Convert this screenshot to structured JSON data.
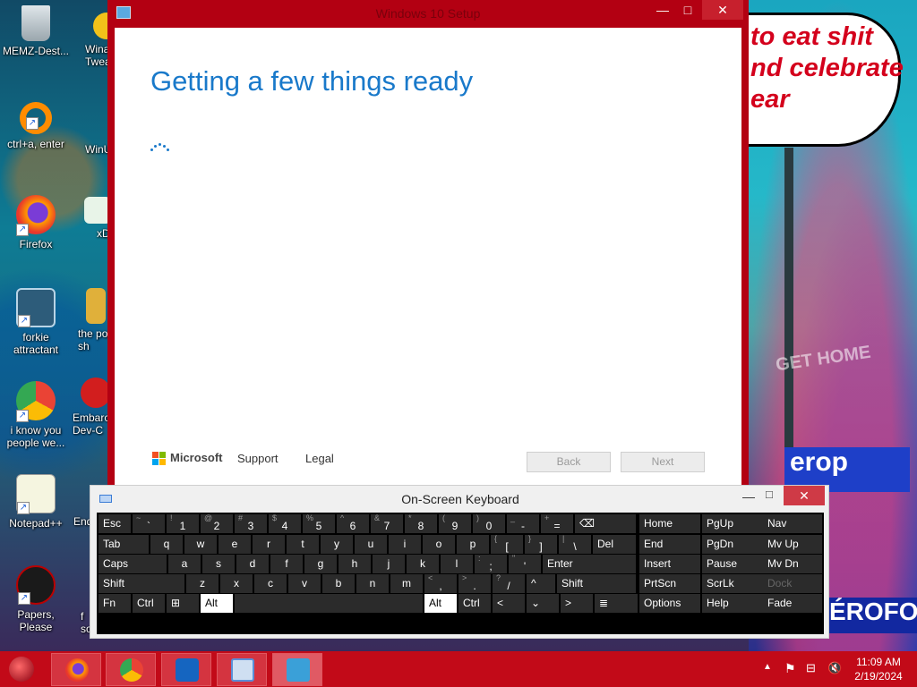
{
  "desktop": {
    "icons": [
      {
        "label": "MEMZ-Dest..."
      },
      {
        "label": "Wina\nTwea"
      },
      {
        "label": "ctrl+a, enter"
      },
      {
        "label": "WinU"
      },
      {
        "label": "Firefox"
      },
      {
        "label": "xD"
      },
      {
        "label": "forkie\nattractant"
      },
      {
        "label": "the po\nsh"
      },
      {
        "label": "i know you\npeople we..."
      },
      {
        "label": "Embarc\nDev-C"
      },
      {
        "label": "Notepad++"
      },
      {
        "label": "End"
      },
      {
        "label": "Papers, Please"
      },
      {
        "label": "f\nsoi"
      }
    ],
    "wallpaper_text": {
      "bubble": [
        "to eat shit",
        "nd celebrate",
        "ear"
      ],
      "sign1": "GET HOME",
      "sign2": "erop",
      "sign3": "ÉROFOS"
    }
  },
  "setup_window": {
    "title": "Windows 10 Setup",
    "heading": "Getting a few things ready",
    "footer": {
      "brand": "Microsoft",
      "support": "Support",
      "legal": "Legal",
      "back": "Back",
      "next": "Next"
    },
    "controls": {
      "min": "—",
      "max": "□",
      "close": "✕"
    }
  },
  "osk": {
    "title": "On-Screen Keyboard",
    "controls": {
      "min": "—",
      "max": "□",
      "close": "✕"
    },
    "rows": [
      [
        {
          "l": "Esc"
        },
        {
          "s": "~",
          "l": "`"
        },
        {
          "s": "!",
          "l": "1"
        },
        {
          "s": "@",
          "l": "2"
        },
        {
          "s": "#",
          "l": "3"
        },
        {
          "s": "$",
          "l": "4"
        },
        {
          "s": "%",
          "l": "5"
        },
        {
          "s": "^",
          "l": "6"
        },
        {
          "s": "&",
          "l": "7"
        },
        {
          "s": "*",
          "l": "8"
        },
        {
          "s": "(",
          "l": "9"
        },
        {
          "s": ")",
          "l": "0"
        },
        {
          "s": "_",
          "l": "-"
        },
        {
          "s": "+",
          "l": "="
        },
        {
          "l": "⌫"
        },
        {
          "l": "Home"
        },
        {
          "l": "PgUp"
        },
        {
          "l": "Nav"
        }
      ],
      [
        {
          "l": "Tab"
        },
        {
          "l": "q"
        },
        {
          "l": "w"
        },
        {
          "l": "e"
        },
        {
          "l": "r"
        },
        {
          "l": "t"
        },
        {
          "l": "y"
        },
        {
          "l": "u"
        },
        {
          "l": "i"
        },
        {
          "l": "o"
        },
        {
          "l": "p"
        },
        {
          "s": "{",
          "l": "["
        },
        {
          "s": "}",
          "l": "]"
        },
        {
          "s": "|",
          "l": "\\"
        },
        {
          "l": "Del"
        },
        {
          "l": "End"
        },
        {
          "l": "PgDn"
        },
        {
          "l": "Mv Up"
        }
      ],
      [
        {
          "l": "Caps"
        },
        {
          "l": "a"
        },
        {
          "l": "s"
        },
        {
          "l": "d"
        },
        {
          "l": "f"
        },
        {
          "l": "g"
        },
        {
          "l": "h"
        },
        {
          "l": "j"
        },
        {
          "l": "k"
        },
        {
          "l": "l"
        },
        {
          "s": ":",
          "l": ";"
        },
        {
          "s": "\"",
          "l": "'"
        },
        {
          "l": "Enter"
        },
        {
          "l": "Insert"
        },
        {
          "l": "Pause"
        },
        {
          "l": "Mv Dn"
        }
      ],
      [
        {
          "l": "Shift"
        },
        {
          "l": "z"
        },
        {
          "l": "x"
        },
        {
          "l": "c"
        },
        {
          "l": "v"
        },
        {
          "l": "b"
        },
        {
          "l": "n"
        },
        {
          "l": "m"
        },
        {
          "s": "<",
          "l": ","
        },
        {
          "s": ">",
          "l": "."
        },
        {
          "s": "?",
          "l": "/"
        },
        {
          "l": "^"
        },
        {
          "l": "Shift"
        },
        {
          "l": "PrtScn"
        },
        {
          "l": "ScrLk"
        },
        {
          "l": "Dock"
        }
      ],
      [
        {
          "l": "Fn"
        },
        {
          "l": "Ctrl"
        },
        {
          "l": "⊞"
        },
        {
          "l": "Alt"
        },
        {
          "l": ""
        },
        {
          "l": "Alt"
        },
        {
          "l": "Ctrl"
        },
        {
          "l": "<"
        },
        {
          "l": "⌄"
        },
        {
          "l": ">"
        },
        {
          "l": "≣"
        },
        {
          "l": "Options"
        },
        {
          "l": "Help"
        },
        {
          "l": "Fade"
        }
      ]
    ]
  },
  "taskbar": {
    "apps": [
      {
        "name": "firefox",
        "color": "#ff7a00"
      },
      {
        "name": "chrome",
        "color": "#34a853"
      },
      {
        "name": "onedrive",
        "color": "#1565c0"
      },
      {
        "name": "on-screen-keyboard",
        "color": "#5a8fd8"
      },
      {
        "name": "windows-setup",
        "color": "#3aa0d8"
      }
    ],
    "tray": {
      "arrow": "▲",
      "flag": "⚑",
      "network": "⊟",
      "volume": "🔇"
    },
    "time": "11:09 AM",
    "date": "2/19/2024"
  },
  "colors": {
    "accent_red": "#c20a18",
    "setup_blue": "#1979ca",
    "ms_red": "#f25022",
    "ms_green": "#7fba00",
    "ms_blue": "#00a4ef",
    "ms_yellow": "#ffb900"
  }
}
